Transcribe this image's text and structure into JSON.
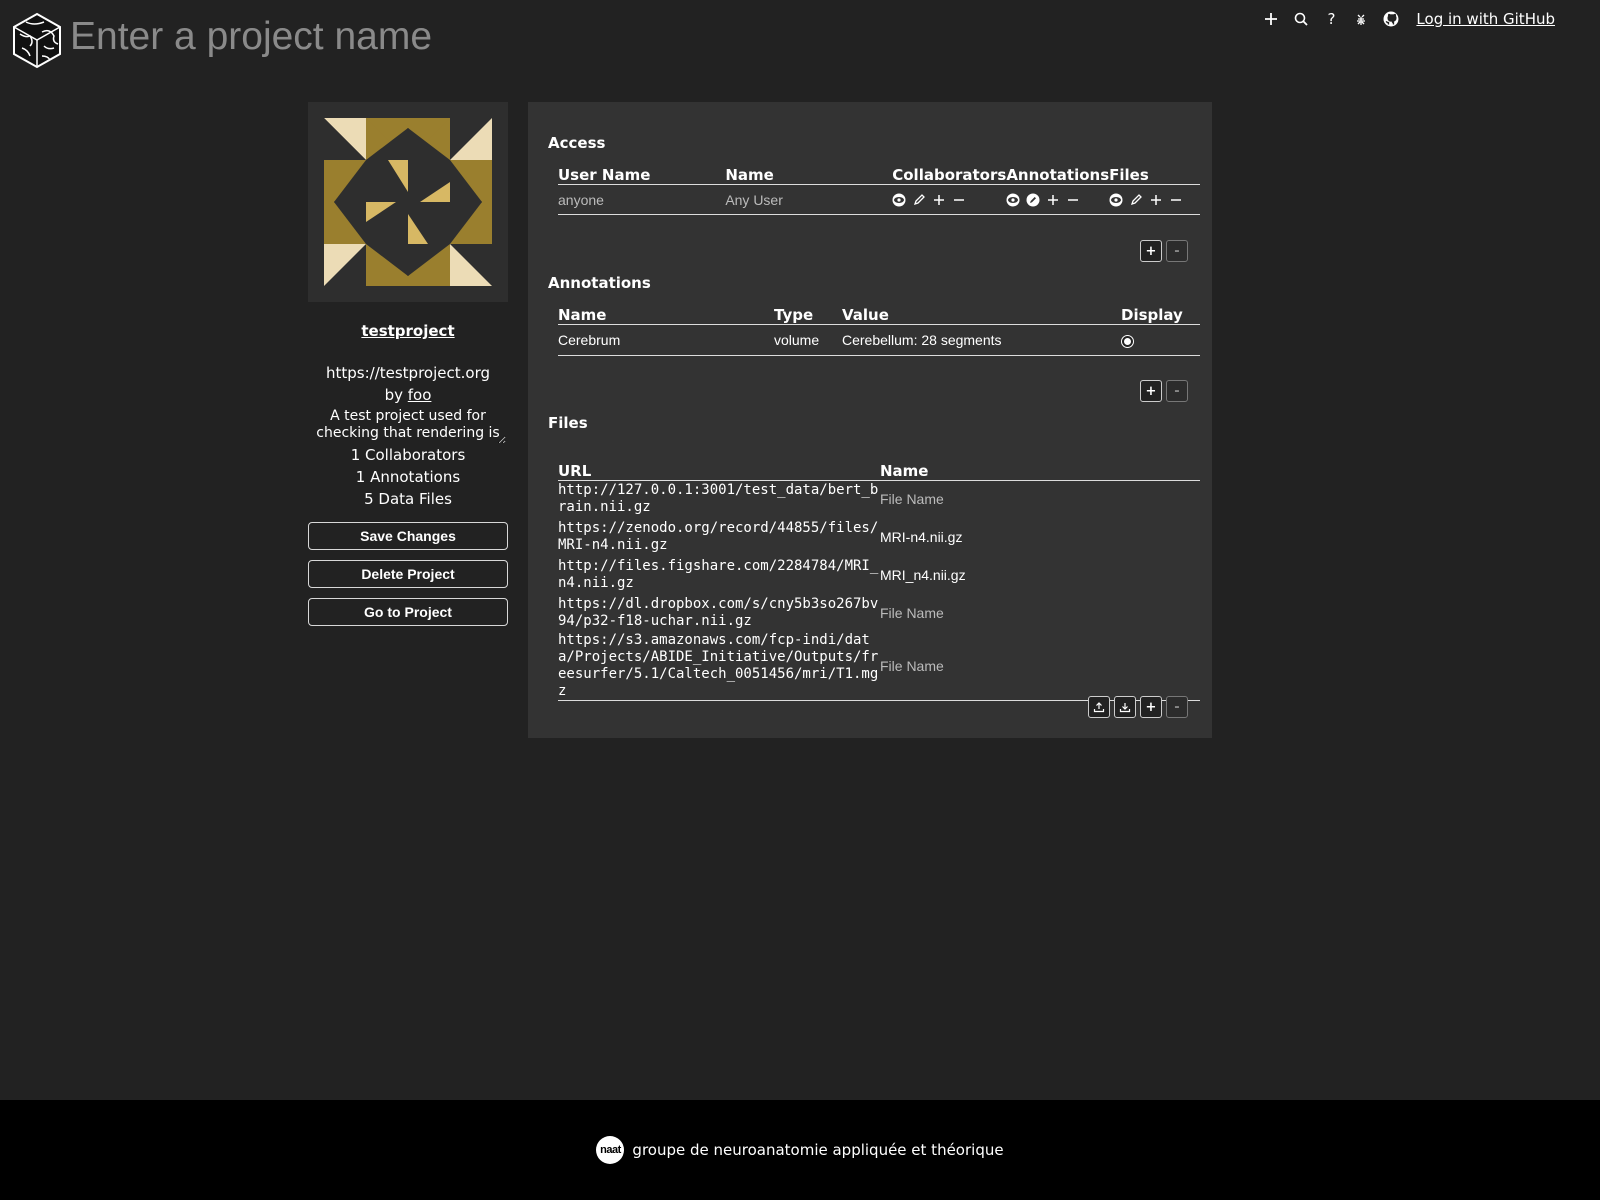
{
  "header": {
    "title_placeholder": "Enter a project name",
    "nav_icons": [
      "plus-icon",
      "search-icon",
      "help-icon",
      "bug-icon",
      "github-icon"
    ],
    "help_glyph": "?",
    "login_label": "Log in with GitHub"
  },
  "sidebar": {
    "project_name": "testproject",
    "project_url": "https://testproject.org",
    "by_label": "by",
    "owner": "foo",
    "description": "A test project used for checking that rendering is",
    "collaborators_count": "1 Collaborators",
    "annotations_count": "1 Annotations",
    "files_count": "5 Data Files",
    "buttons": {
      "save": "Save Changes",
      "delete": "Delete Project",
      "goto": "Go to Project"
    }
  },
  "access": {
    "title": "Access",
    "columns": [
      "User Name",
      "Name",
      "Collaborators",
      "Annotations",
      "Files"
    ],
    "rows": [
      {
        "username": "anyone",
        "name": "Any User"
      }
    ],
    "add_label": "+",
    "remove_label": "-"
  },
  "annotations": {
    "title": "Annotations",
    "columns": [
      "Name",
      "Type",
      "Value",
      "Display"
    ],
    "rows": [
      {
        "name": "Cerebrum",
        "type": "volume",
        "value": "Cerebellum: 28 segments",
        "display": true
      }
    ],
    "add_label": "+",
    "remove_label": "-"
  },
  "files": {
    "title": "Files",
    "columns": [
      "URL",
      "Name"
    ],
    "rows": [
      {
        "url": "http://127.0.0.1:3001/test_data/bert_brain.nii.gz",
        "name": "",
        "placeholder": "File Name"
      },
      {
        "url": "https://zenodo.org/record/44855/files/MRI-n4.nii.gz",
        "name": "MRI-n4.nii.gz",
        "placeholder": "File Name"
      },
      {
        "url": "http://files.figshare.com/2284784/MRI_n4.nii.gz",
        "name": "MRI_n4.nii.gz",
        "placeholder": "File Name"
      },
      {
        "url": "https://dl.dropbox.com/s/cny5b3so267bv94/p32-f18-uchar.nii.gz",
        "name": "",
        "placeholder": "File Name"
      },
      {
        "url": "https://s3.amazonaws.com/fcp-indi/data/Projects/ABIDE_Initiative/Outputs/freesurfer/5.1/Caltech_0051456/mri/T1.mgz",
        "name": "",
        "placeholder": "File Name"
      }
    ],
    "add_label": "+",
    "remove_label": "-"
  },
  "footer": {
    "logo_text": "naat",
    "text": "groupe de neuroanatomie appliquée et théorique"
  }
}
